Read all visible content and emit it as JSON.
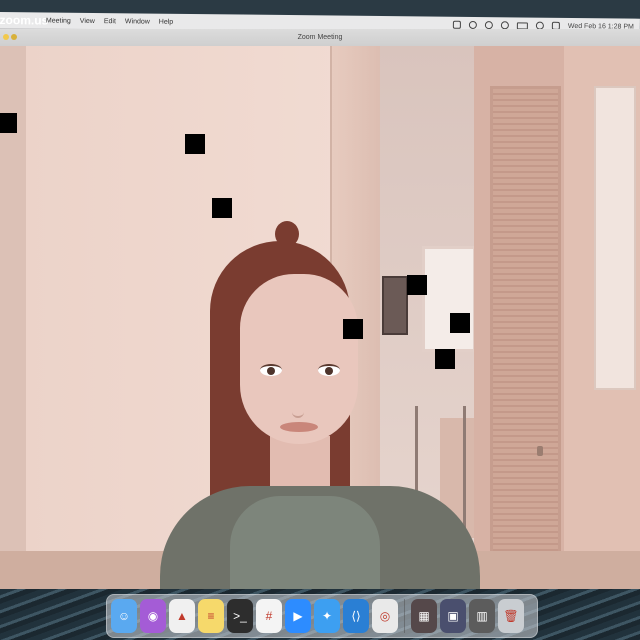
{
  "menubar": {
    "apple": "",
    "app_name": "zoom.us",
    "items": [
      "Meeting",
      "View",
      "Edit",
      "Window",
      "Help"
    ],
    "clock": "Wed Feb 16  1:28 PM"
  },
  "window": {
    "title": "Zoom Meeting"
  },
  "dock": {
    "apps": [
      {
        "name": "finder-icon",
        "glyph": "☺",
        "color": "#5aa9f0"
      },
      {
        "name": "podcasts-icon",
        "glyph": "◉",
        "color": "#a45cd6"
      },
      {
        "name": "brave-icon",
        "glyph": "▲",
        "color": "#f0f0f0"
      },
      {
        "name": "notes-icon",
        "glyph": "≡",
        "color": "#f6d96b"
      },
      {
        "name": "terminal-icon",
        "glyph": ">_",
        "color": "#2d2d2d"
      },
      {
        "name": "slack-icon",
        "glyph": "#",
        "color": "#f4f4f4"
      },
      {
        "name": "zoom-icon",
        "glyph": "▶",
        "color": "#2d8cff"
      },
      {
        "name": "safari-icon",
        "glyph": "✦",
        "color": "#3d9ff1"
      },
      {
        "name": "vscode-icon",
        "glyph": "⟨⟩",
        "color": "#2a7fd4"
      },
      {
        "name": "chrome-icon",
        "glyph": "◎",
        "color": "#e9e9e9"
      },
      {
        "name": "photos-stack-icon",
        "glyph": "▦",
        "color": "#55484a"
      },
      {
        "name": "app-window-icon",
        "glyph": "▣",
        "color": "#4a4f6e"
      },
      {
        "name": "downloads-stack-icon",
        "glyph": "▥",
        "color": "#5c5c5c"
      },
      {
        "name": "trash-icon",
        "glyph": "🗑",
        "color": "#c9cdd1"
      }
    ]
  }
}
